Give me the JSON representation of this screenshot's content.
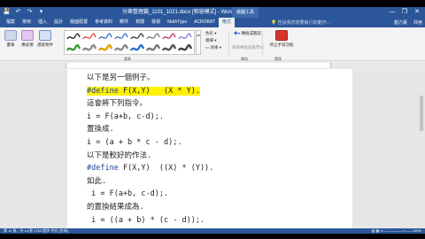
{
  "titlebar": {
    "quick_access": [
      "💾",
      "↶",
      "↷",
      "▾"
    ],
    "title": "分章整理篇_1101_1021.docx [相容模式] - Word",
    "contextual_tab": "繪圖工具",
    "controls": [
      "—",
      "❐",
      "✕"
    ]
  },
  "tabs": {
    "items": [
      "檔案",
      "常用",
      "插入",
      "設計",
      "版面配置",
      "參考資料",
      "郵件",
      "校閱",
      "檢視",
      "MathType",
      "ACROBAT",
      "格式"
    ],
    "active_index": 11,
    "tell_me": "告訴我您想要執行的動作...",
    "user": "劉力豪",
    "share": "共用"
  },
  "ribbon": {
    "buttons": [
      {
        "label": "畫筆",
        "color": "#555"
      },
      {
        "label": "橡皮擦",
        "color": "#c07fd6"
      },
      {
        "label": "選取物件",
        "color": "#4a7ac9"
      }
    ],
    "gallery_pens": [
      "#1a1a1a",
      "#e04040",
      "#3a68c8",
      "#3a68c8",
      "#333333",
      "#777777",
      "#c03050",
      "#7c7cd0",
      "#3a9a3a",
      "#8a8a8a",
      "#e0a000",
      "#888888",
      "#2c78c8",
      "#777777",
      "#555555",
      "#444444"
    ],
    "gallery_scroll": "▴▾",
    "pen_options": [
      "色彩 ▾",
      "粗細 ▾",
      "▭ 效果 ▾"
    ],
    "convert_label": "轉換成圖案",
    "ink_to_math": "筆跡轉換成數學式",
    "stop_label": "停止手寫功能",
    "groups": [
      "畫筆",
      "轉換",
      "關閉"
    ]
  },
  "document": {
    "lines": [
      {
        "text": "以下是另一個例子。",
        "highlight": false,
        "kw": ""
      },
      {
        "text": " F(X,Y)   (X * Y).",
        "highlight": true,
        "kw": "#define"
      },
      {
        "text": "這會將下列指令。",
        "highlight": false,
        "kw": ""
      },
      {
        "text": "i = F(a+b, c-d);.",
        "highlight": false,
        "kw": ""
      },
      {
        "text": "置換成.",
        "highlight": false,
        "kw": ""
      },
      {
        "text": "i = (a + b * c - d);.",
        "highlight": false,
        "kw": ""
      },
      {
        "text": "以下是較好的作法.",
        "highlight": false,
        "kw": ""
      },
      {
        "text": " F(X,Y)  ((X) * (Y)).",
        "highlight": false,
        "kw": "#define"
      },
      {
        "text": "如此.",
        "highlight": false,
        "kw": ""
      },
      {
        "text": " i = F(a+b, c-d);.",
        "highlight": false,
        "kw": ""
      },
      {
        "text": "的置換結果成為.",
        "highlight": false,
        "kw": ""
      },
      {
        "text": " i = ((a + b) * (c - d));.",
        "highlight": false,
        "kw": ""
      }
    ]
  },
  "status": {
    "left": "第 11 頁，共 14 頁    1764 個字    中文 (台灣)",
    "right": "▤  ▦  ▭   —————+——  100%"
  }
}
